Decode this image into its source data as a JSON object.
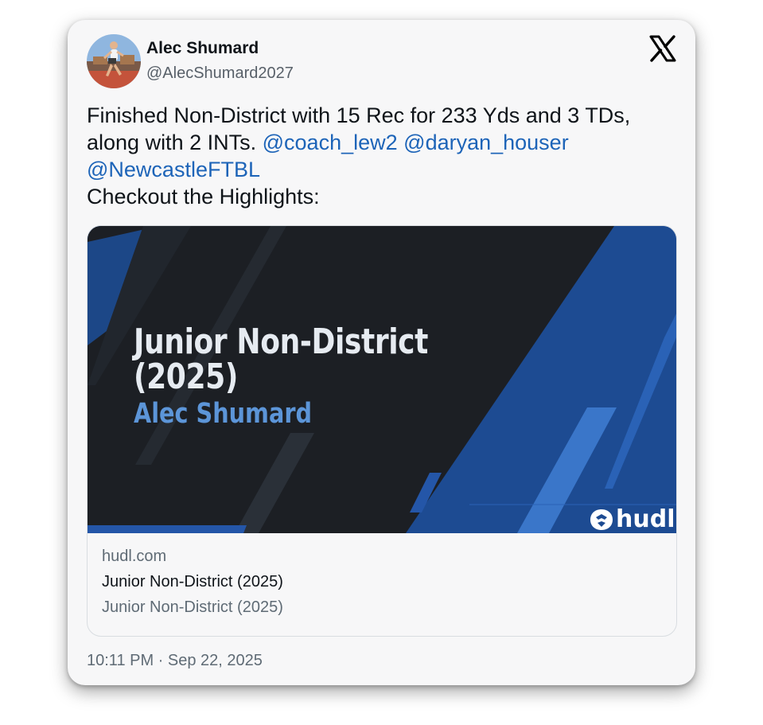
{
  "author": {
    "name": "Alec Shumard",
    "handle": "@AlecShumard2027"
  },
  "tweet": {
    "text_line1": "Finished Non-District with 15 Rec for 233 Yds and 3 TDs,",
    "text_line2": "along with 2 INTs.",
    "mentions": [
      "@coach_lew2",
      "@daryan_houser",
      "@NewcastleFTBL"
    ],
    "text_line4": "Checkout the Highlights:"
  },
  "link_card": {
    "thumbnail_title": "Junior Non-District (2025)",
    "thumbnail_subtitle": "Alec Shumard",
    "thumbnail_logo_text": "hudl",
    "domain": "hudl.com",
    "title": "Junior Non-District (2025)",
    "description": "Junior Non-District (2025)"
  },
  "timestamp": "10:11 PM · Sep 22, 2025",
  "colors": {
    "mention": "#1d64b8",
    "thumb_blue": "#1d4b92",
    "thumb_dark": "#1c1f24",
    "subtitle_blue": "#5c95d8"
  },
  "icons": {
    "platform": "x-logo-icon",
    "hudl": "hudl-logo-icon"
  }
}
